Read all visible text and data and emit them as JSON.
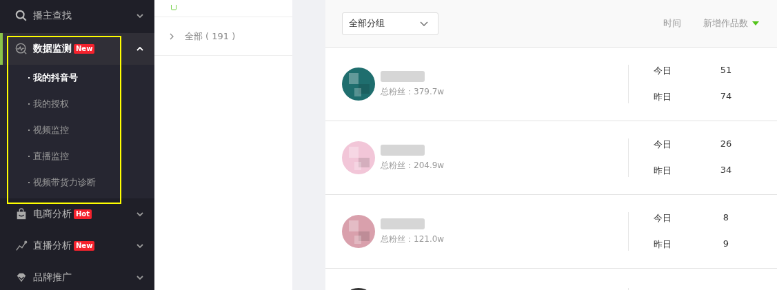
{
  "sidebar": {
    "items": [
      {
        "label": "播主查找",
        "expanded": false,
        "selected": false
      },
      {
        "label": "数据监测",
        "badge": "New",
        "expanded": true,
        "selected": true,
        "highlighted": true,
        "children": [
          {
            "label": "我的抖音号",
            "selected": true
          },
          {
            "label": "我的授权",
            "selected": false
          },
          {
            "label": "视频监控",
            "selected": false
          },
          {
            "label": "直播监控",
            "selected": false
          },
          {
            "label": "视频带货力诊断",
            "selected": false
          }
        ]
      },
      {
        "label": "电商分析",
        "badge": "Hot",
        "expanded": false,
        "selected": false
      },
      {
        "label": "直播分析",
        "badge": "New",
        "expanded": false,
        "selected": false
      },
      {
        "label": "品牌推广",
        "expanded": false,
        "selected": false
      }
    ]
  },
  "groups": {
    "items": [
      {
        "label": "全部",
        "count": "( 191 )",
        "expanded": false
      }
    ]
  },
  "list": {
    "group_select": {
      "value": "全部分组"
    },
    "columns": [
      {
        "label": "时间",
        "sorted": false
      },
      {
        "label": "新增作品数",
        "sorted": true
      }
    ],
    "rows": [
      {
        "kind": "account",
        "fans": "总粉丝：379.7w",
        "today_label": "今日",
        "today": "51",
        "yesterday_label": "昨日",
        "yesterday": "74"
      },
      {
        "kind": "account",
        "fans": "总粉丝：204.9w",
        "today_label": "今日",
        "today": "26",
        "yesterday_label": "昨日",
        "yesterday": "34"
      },
      {
        "kind": "account",
        "fans": "总粉丝：121.0w",
        "today_label": "今日",
        "today": "8",
        "yesterday_label": "昨日",
        "yesterday": "9"
      },
      {
        "kind": "cut-off"
      }
    ]
  }
}
